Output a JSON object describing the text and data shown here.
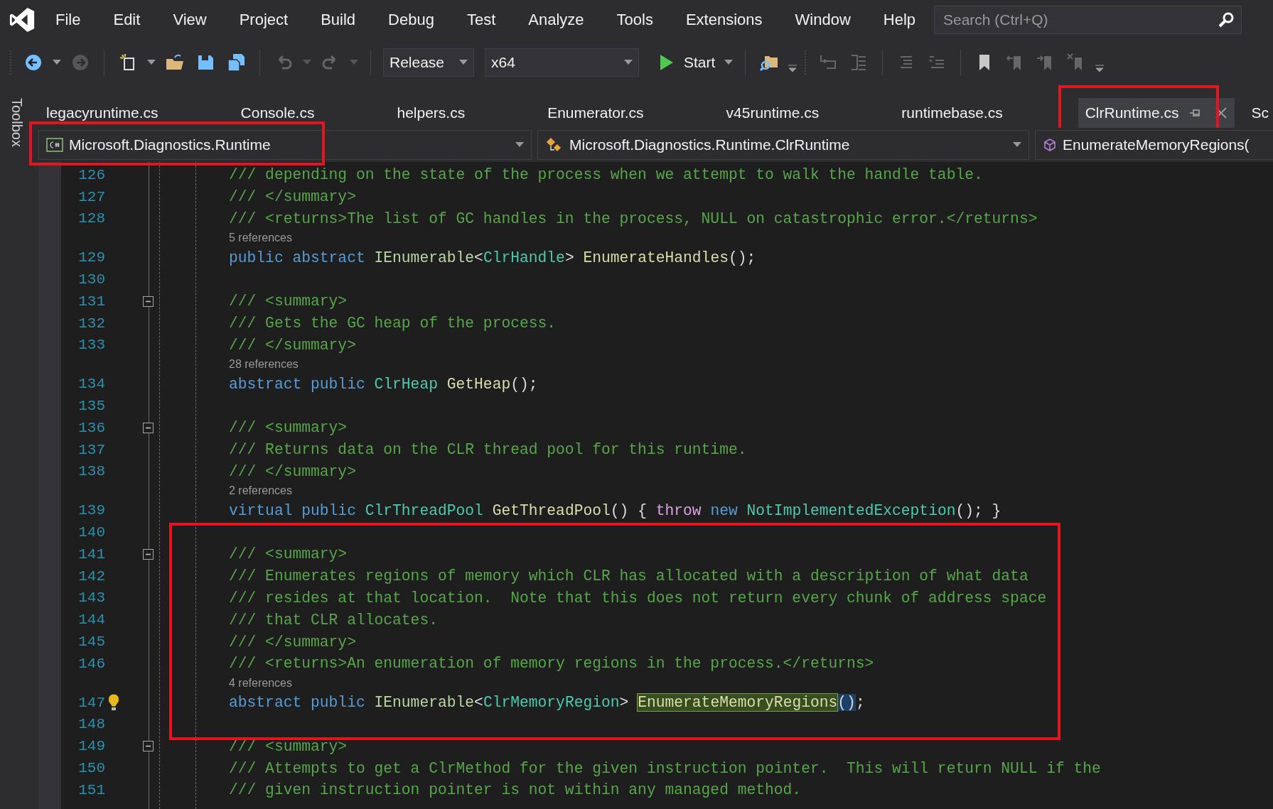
{
  "menu": {
    "items": [
      "File",
      "Edit",
      "View",
      "Project",
      "Build",
      "Debug",
      "Test",
      "Analyze",
      "Tools",
      "Extensions",
      "Window",
      "Help"
    ]
  },
  "search": {
    "placeholder": "Search (Ctrl+Q)"
  },
  "toolbar": {
    "configuration": "Release",
    "platform": "x64",
    "start": "Start"
  },
  "toolbox": {
    "label": "Toolbox"
  },
  "tabs": [
    {
      "label": "legacyruntime.cs",
      "selected": false
    },
    {
      "label": "Console.cs",
      "selected": false
    },
    {
      "label": "helpers.cs",
      "selected": false
    },
    {
      "label": "Enumerator.cs",
      "selected": false
    },
    {
      "label": "v45runtime.cs",
      "selected": false
    },
    {
      "label": "runtimebase.cs",
      "selected": false
    },
    {
      "label": "ClrRuntime.cs",
      "selected": true,
      "framed": true
    },
    {
      "label": "Sc",
      "selected": false
    }
  ],
  "navigation": {
    "project": "Microsoft.Diagnostics.Runtime",
    "project_framed": true,
    "type": "Microsoft.Diagnostics.Runtime.ClrRuntime",
    "member": "EnumerateMemoryRegions("
  },
  "blocks": [
    {
      "framed": false,
      "lines": [
        {
          "kind": "code",
          "number": "126",
          "fold": false,
          "tokens": [
            {
              "kind": "comment",
              "text": "/// depending on the state of the process when we attempt to walk the handle table."
            }
          ]
        },
        {
          "kind": "code",
          "number": "127",
          "fold": false,
          "tokens": [
            {
              "kind": "comment",
              "text": "/// </summary>"
            }
          ]
        },
        {
          "kind": "code",
          "number": "128",
          "fold": false,
          "tokens": [
            {
              "kind": "comment",
              "text": "/// <returns>The list of GC handles in the process, NULL on catastrophic error.</returns>"
            }
          ]
        },
        {
          "kind": "lens",
          "text": "5 references"
        },
        {
          "kind": "code",
          "number": "129",
          "fold": false,
          "tokens": [
            {
              "kind": "keyword",
              "text": "public "
            },
            {
              "kind": "keyword",
              "text": "abstract "
            },
            {
              "kind": "interface",
              "text": "IEnumerable"
            },
            {
              "kind": "plain",
              "text": "<"
            },
            {
              "kind": "type",
              "text": "ClrHandle"
            },
            {
              "kind": "plain",
              "text": "> "
            },
            {
              "kind": "method",
              "text": "EnumerateHandles"
            },
            {
              "kind": "plain",
              "text": "();"
            }
          ]
        },
        {
          "kind": "code",
          "number": "130",
          "fold": false
        },
        {
          "kind": "code",
          "number": "131",
          "fold": true,
          "tokens": [
            {
              "kind": "comment",
              "text": "/// <summary>"
            }
          ]
        },
        {
          "kind": "code",
          "number": "132",
          "fold": false,
          "tokens": [
            {
              "kind": "comment",
              "text": "/// Gets the GC heap of the process."
            }
          ]
        },
        {
          "kind": "code",
          "number": "133",
          "fold": false,
          "tokens": [
            {
              "kind": "comment",
              "text": "/// </summary>"
            }
          ]
        },
        {
          "kind": "lens",
          "text": "28 references"
        },
        {
          "kind": "code",
          "number": "134",
          "fold": false,
          "tokens": [
            {
              "kind": "keyword",
              "text": "abstract "
            },
            {
              "kind": "keyword",
              "text": "public "
            },
            {
              "kind": "type",
              "text": "ClrHeap "
            },
            {
              "kind": "method",
              "text": "GetHeap"
            },
            {
              "kind": "plain",
              "text": "();"
            }
          ]
        },
        {
          "kind": "code",
          "number": "135",
          "fold": false
        },
        {
          "kind": "code",
          "number": "136",
          "fold": true,
          "tokens": [
            {
              "kind": "comment",
              "text": "/// <summary>"
            }
          ]
        },
        {
          "kind": "code",
          "number": "137",
          "fold": false,
          "tokens": [
            {
              "kind": "comment",
              "text": "/// Returns data on the CLR thread pool for this runtime."
            }
          ]
        },
        {
          "kind": "code",
          "number": "138",
          "fold": false,
          "tokens": [
            {
              "kind": "comment",
              "text": "/// </summary>"
            }
          ]
        },
        {
          "kind": "lens",
          "text": "2 references"
        },
        {
          "kind": "code",
          "number": "139",
          "fold": false,
          "tokens": [
            {
              "kind": "keyword",
              "text": "virtual "
            },
            {
              "kind": "keyword",
              "text": "public "
            },
            {
              "kind": "type",
              "text": "ClrThreadPool "
            },
            {
              "kind": "method",
              "text": "GetThreadPool"
            },
            {
              "kind": "plain",
              "text": "() { "
            },
            {
              "kind": "control",
              "text": "throw "
            },
            {
              "kind": "keyword",
              "text": "new "
            },
            {
              "kind": "type",
              "text": "NotImplementedException"
            },
            {
              "kind": "plain",
              "text": "(); }"
            }
          ]
        }
      ]
    },
    {
      "framed": true,
      "lines": [
        {
          "kind": "code",
          "number": "140",
          "fold": false
        },
        {
          "kind": "code",
          "number": "141",
          "fold": true,
          "tokens": [
            {
              "kind": "comment",
              "text": "/// <summary>"
            }
          ]
        },
        {
          "kind": "code",
          "number": "142",
          "fold": false,
          "tokens": [
            {
              "kind": "comment",
              "text": "/// Enumerates regions of memory which CLR has allocated with a description of what data"
            }
          ]
        },
        {
          "kind": "code",
          "number": "143",
          "fold": false,
          "tokens": [
            {
              "kind": "comment",
              "text": "/// resides at that location.  Note that this does not return every chunk of address space"
            }
          ]
        },
        {
          "kind": "code",
          "number": "144",
          "fold": false,
          "tokens": [
            {
              "kind": "comment",
              "text": "/// that CLR allocates."
            }
          ]
        },
        {
          "kind": "code",
          "number": "145",
          "fold": false,
          "tokens": [
            {
              "kind": "comment",
              "text": "/// </summary>"
            }
          ]
        },
        {
          "kind": "code",
          "number": "146",
          "fold": false,
          "tokens": [
            {
              "kind": "comment",
              "text": "/// <returns>An enumeration of memory regions in the process.</returns>"
            }
          ]
        },
        {
          "kind": "lens",
          "text": "4 references"
        },
        {
          "kind": "code",
          "number": "147",
          "fold": false,
          "lightbulb": true,
          "tokens": [
            {
              "kind": "keyword",
              "text": "abstract "
            },
            {
              "kind": "keyword",
              "text": "public "
            },
            {
              "kind": "interface",
              "text": "IEnumerable"
            },
            {
              "kind": "plain",
              "text": "<"
            },
            {
              "kind": "type",
              "text": "ClrMemoryRegion"
            },
            {
              "kind": "plain",
              "text": "> "
            },
            {
              "kind": "highlight",
              "text": "EnumerateMemoryRegions"
            },
            {
              "kind": "brace",
              "text": "()"
            },
            {
              "kind": "plain",
              "text": ";"
            }
          ]
        },
        {
          "kind": "code",
          "number": "148",
          "fold": false
        }
      ]
    },
    {
      "framed": false,
      "lines": [
        {
          "kind": "code",
          "number": "149",
          "fold": true,
          "tokens": [
            {
              "kind": "comment",
              "text": "/// <summary>"
            }
          ]
        },
        {
          "kind": "code",
          "number": "150",
          "fold": false,
          "tokens": [
            {
              "kind": "comment",
              "text": "/// Attempts to get a ClrMethod for the given instruction pointer.  This will return NULL if the"
            }
          ]
        },
        {
          "kind": "code",
          "number": "151",
          "fold": false,
          "tokens": [
            {
              "kind": "comment",
              "text": "/// given instruction pointer is not within any managed method."
            }
          ]
        }
      ]
    }
  ]
}
